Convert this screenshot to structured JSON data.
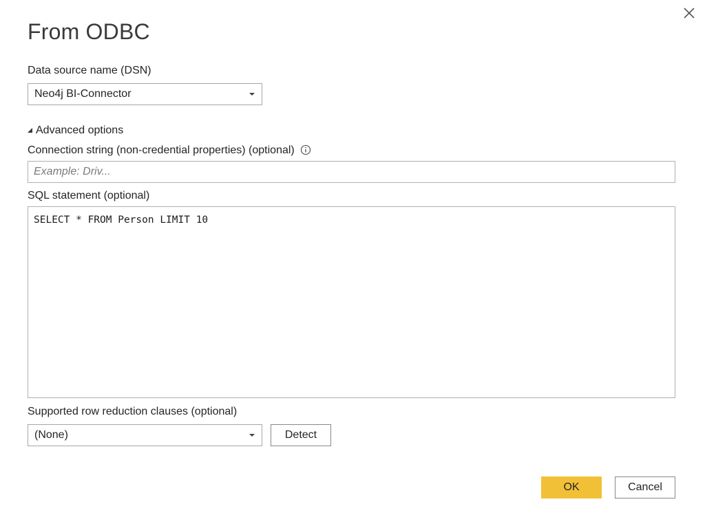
{
  "dialog": {
    "title": "From ODBC",
    "close_icon": "close-icon"
  },
  "dsn": {
    "label": "Data source name (DSN)",
    "selected": "Neo4j BI-Connector"
  },
  "advanced": {
    "toggle_label": "Advanced options",
    "expanded": true,
    "connection_string": {
      "label": "Connection string (non-credential properties) (optional)",
      "info_icon": "info-icon",
      "value": "",
      "placeholder": "Example: Driv..."
    },
    "sql": {
      "label": "SQL statement (optional)",
      "value": "SELECT * FROM Person LIMIT 10"
    },
    "row_reduction": {
      "label": "Supported row reduction clauses (optional)",
      "selected": "(None)",
      "detect_label": "Detect"
    }
  },
  "footer": {
    "ok_label": "OK",
    "cancel_label": "Cancel"
  },
  "colors": {
    "primary_button": "#f2c037",
    "border": "#a6a6a6",
    "text": "#252423"
  }
}
